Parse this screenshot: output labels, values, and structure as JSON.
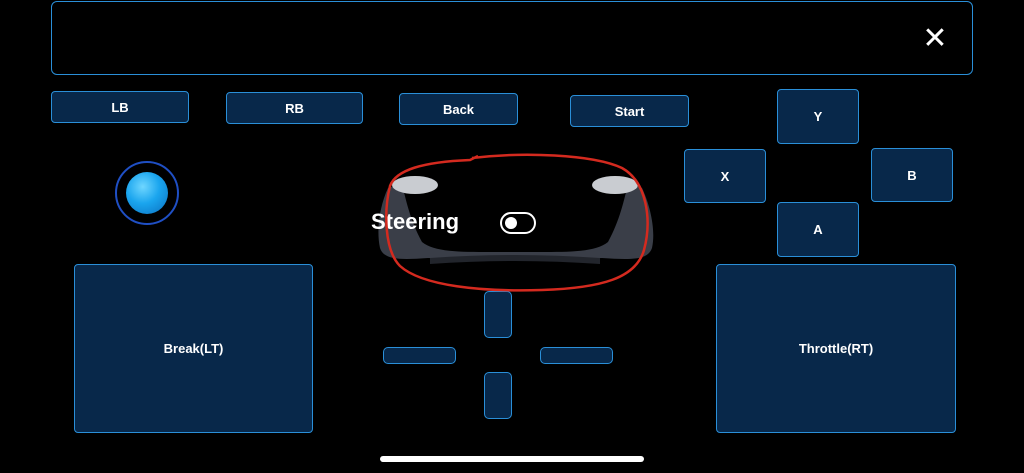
{
  "topbar": {
    "close_icon": "close-icon"
  },
  "shoulder": {
    "lb": "LB",
    "rb": "RB"
  },
  "menu": {
    "back": "Back",
    "start": "Start"
  },
  "face": {
    "y": "Y",
    "x": "X",
    "b": "B",
    "a": "A"
  },
  "triggers": {
    "brake": "Break(LT)",
    "throttle": "Throttle(RT)"
  },
  "steering": {
    "label": "Steering",
    "toggle_state": "on"
  },
  "colors": {
    "button_fill": "#08284a",
    "button_border": "#2a8fd8",
    "joystick": "#1aa5ee",
    "annotation": "#d42a1f"
  }
}
